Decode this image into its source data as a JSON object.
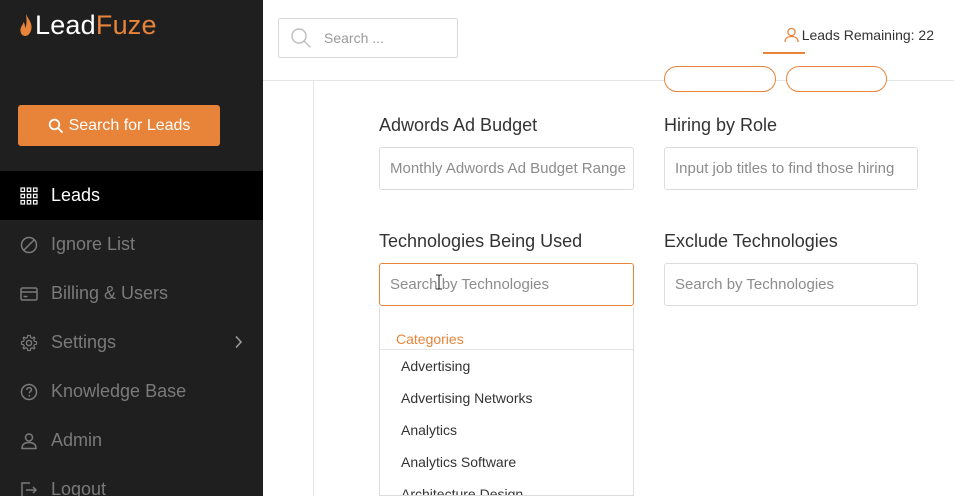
{
  "logo": {
    "part1": "Lead",
    "part2": "Fuze"
  },
  "sidebar": {
    "search_button": "Search for Leads",
    "items": [
      {
        "label": "Leads",
        "icon": "grid-icon",
        "active": true
      },
      {
        "label": "Ignore List",
        "icon": "ban-icon"
      },
      {
        "label": "Billing & Users",
        "icon": "credit-card-icon"
      },
      {
        "label": "Settings",
        "icon": "gear-icon",
        "has_submenu": true
      },
      {
        "label": "Knowledge Base",
        "icon": "question-circle-icon"
      },
      {
        "label": "Admin",
        "icon": "user-icon"
      },
      {
        "label": "Logout",
        "icon": "logout-icon"
      }
    ]
  },
  "header": {
    "search_placeholder": "Search ...",
    "leads_remaining": "Leads Remaining: 22"
  },
  "form": {
    "adwords": {
      "label": "Adwords Ad Budget",
      "placeholder": "Monthly Adwords Ad Budget Range"
    },
    "hiring": {
      "label": "Hiring by Role",
      "placeholder": "Input job titles to find those hiring"
    },
    "technologies": {
      "label": "Technologies Being Used",
      "placeholder": "Search by Technologies"
    },
    "exclude": {
      "label": "Exclude Technologies",
      "placeholder": "Search by Technologies"
    }
  },
  "dropdown": {
    "header": "Categories",
    "items": [
      "Advertising",
      "Advertising Networks",
      "Analytics",
      "Analytics Software",
      "Architecture Design"
    ]
  },
  "colors": {
    "accent": "#e8843a",
    "sidebar_bg": "#1f1f1f",
    "active_bg": "#000000"
  }
}
